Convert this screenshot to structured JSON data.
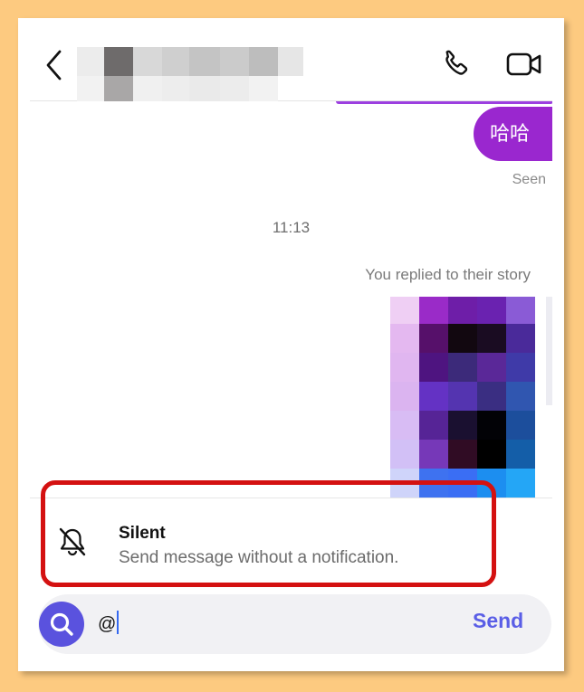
{
  "header": {
    "back_icon": "chevron-left-icon",
    "contact_name_hidden": true,
    "call_icon": "phone-icon",
    "video_icon": "video-camera-icon"
  },
  "messages": {
    "sent_bubble_text": "哈哈",
    "seen_label": "Seen",
    "timestamp": "11:13",
    "story_reply_note": "You replied to their story"
  },
  "suggestion": {
    "icon": "bell-off-icon",
    "title": "Silent",
    "description": "Send message without a notification."
  },
  "composer": {
    "input_value": "@",
    "send_label": "Send",
    "search_icon": "search-icon"
  },
  "colors": {
    "bubble": "#9a27cf",
    "accent": "#5a52de",
    "send": "#5a5ee6",
    "highlight_border": "#d41111",
    "page_background": "#fdca80"
  }
}
